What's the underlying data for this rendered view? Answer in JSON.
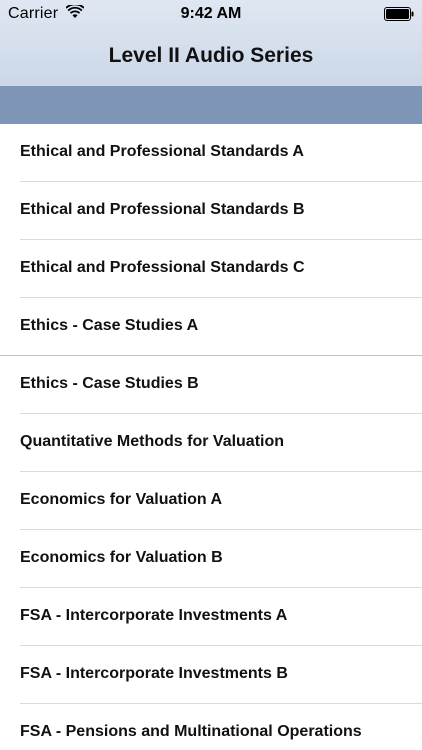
{
  "status_bar": {
    "carrier": "Carrier",
    "time": "9:42 AM",
    "wifi_icon": "wifi-icon",
    "battery_icon": "battery-icon"
  },
  "nav": {
    "title": "Level II Audio Series"
  },
  "colors": {
    "nav_background": "#d5dfed",
    "sub_band": "#7f95b7",
    "separator": "#d9d9de"
  },
  "list": {
    "items": [
      {
        "label": "Ethical and Professional Standards A"
      },
      {
        "label": "Ethical and Professional Standards B"
      },
      {
        "label": "Ethical and Professional Standards C"
      },
      {
        "label": "Ethics - Case Studies A"
      },
      {
        "label": "Ethics - Case Studies B"
      },
      {
        "label": "Quantitative Methods for Valuation"
      },
      {
        "label": "Economics for Valuation A"
      },
      {
        "label": "Economics for Valuation B"
      },
      {
        "label": "FSA - Intercorporate Investments A"
      },
      {
        "label": "FSA - Intercorporate Investments B"
      },
      {
        "label": "FSA - Pensions and Multinational Operations"
      }
    ]
  }
}
